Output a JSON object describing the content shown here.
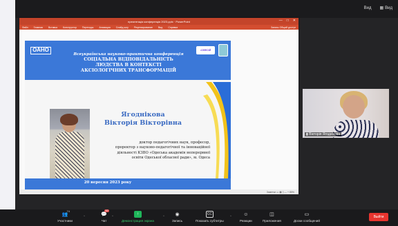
{
  "top_bar": {
    "view_label": "Вид",
    "exit_label": "Вид"
  },
  "powerpoint": {
    "title": "презентація конференція 2023.pptx · PowerPoint",
    "window_controls": [
      "—",
      "□",
      "✕"
    ],
    "ribbon_tabs": [
      "Файл",
      "Главная",
      "Вставка",
      "Конструктор",
      "Переходы",
      "Анимация",
      "Слайд-шоу",
      "Рецензирование",
      "Вид",
      "Справка"
    ],
    "ribbon_right": "Запись   Общий доступ",
    "status_text": "Заметки   ▭  ▦  ▯  —  +  85%"
  },
  "slide": {
    "logo": "ОАНО",
    "conference_line1": "Всеукраїнська науково-практична конференція",
    "conference_line2": "СОЦІАЛЬНА ВІДПОВІДАЛЬНІСТЬ",
    "conference_line3": "ЛЮДСТВА В КОНТЕКСТІ",
    "conference_line4": "АКСІОЛОГІЧНИХ ТРАНСФОРМАЦІЙ",
    "badge_text": "•ОФЕСІЙ",
    "name_line1": "Ягоднікова",
    "name_line2": "Вікторія Вікторівна",
    "bio_line1": "доктор педагогічних наук, професор,",
    "bio_line2": "проректор з науково-педагогічної та інноваційної",
    "bio_line3": "діяльності КЗВО «Одеська академія неперервної",
    "bio_line4": "освіти Одеської обласної ради», м. Одеса",
    "date": "20 вересня 2023 року"
  },
  "video": {
    "participant_name": "Вікторія Ягоднікова"
  },
  "toolbar": {
    "participants_label": "Участники",
    "participants_count": "74",
    "chat_label": "Чат",
    "chat_badge": "60",
    "share_label": "Демонстрация экрана",
    "record_label": "Запись",
    "captions_label": "Показать субтитры",
    "reactions_label": "Реакции",
    "apps_label": "Приложения",
    "whiteboard_label": "Доски сообщений",
    "exit_label": "Выйти"
  },
  "colors": {
    "slide_blue": "#3b78d8",
    "name_blue": "#3b6bc2",
    "powerpoint_red": "#c4442a",
    "zoom_green": "#1fb55a",
    "exit_red": "#e8352f"
  }
}
